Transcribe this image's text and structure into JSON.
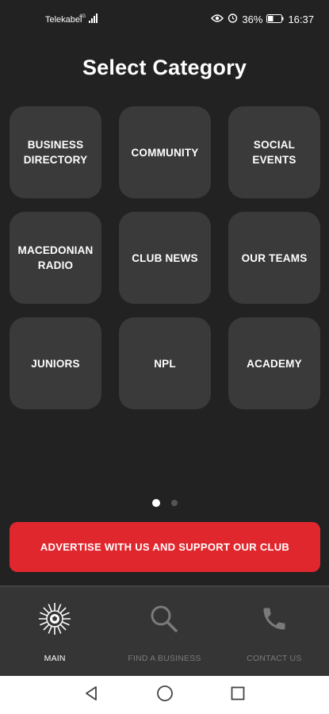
{
  "status_bar": {
    "carrier": "Telekabel",
    "battery": "36%",
    "time": "16:37"
  },
  "title": "Select Category",
  "categories": [
    {
      "label": "BUSINESS\nDIRECTORY"
    },
    {
      "label": "COMMUNITY"
    },
    {
      "label": "SOCIAL\nEVENTS"
    },
    {
      "label": "MACEDONIAN\nRADIO"
    },
    {
      "label": "CLUB NEWS"
    },
    {
      "label": "OUR TEAMS"
    },
    {
      "label": "JUNIORS"
    },
    {
      "label": "NPL"
    },
    {
      "label": "ACADEMY"
    }
  ],
  "pager": {
    "pages": 2,
    "current": 1
  },
  "advert_button": "ADVERTISE WITH US AND SUPPORT OUR CLUB",
  "bottom_nav": {
    "main": "MAIN",
    "find_business": "FIND A BUSINESS",
    "contact": "CONTACT US"
  },
  "colors": {
    "accent": "#e1272e",
    "background": "#222222",
    "tile": "#3a3a3a"
  }
}
